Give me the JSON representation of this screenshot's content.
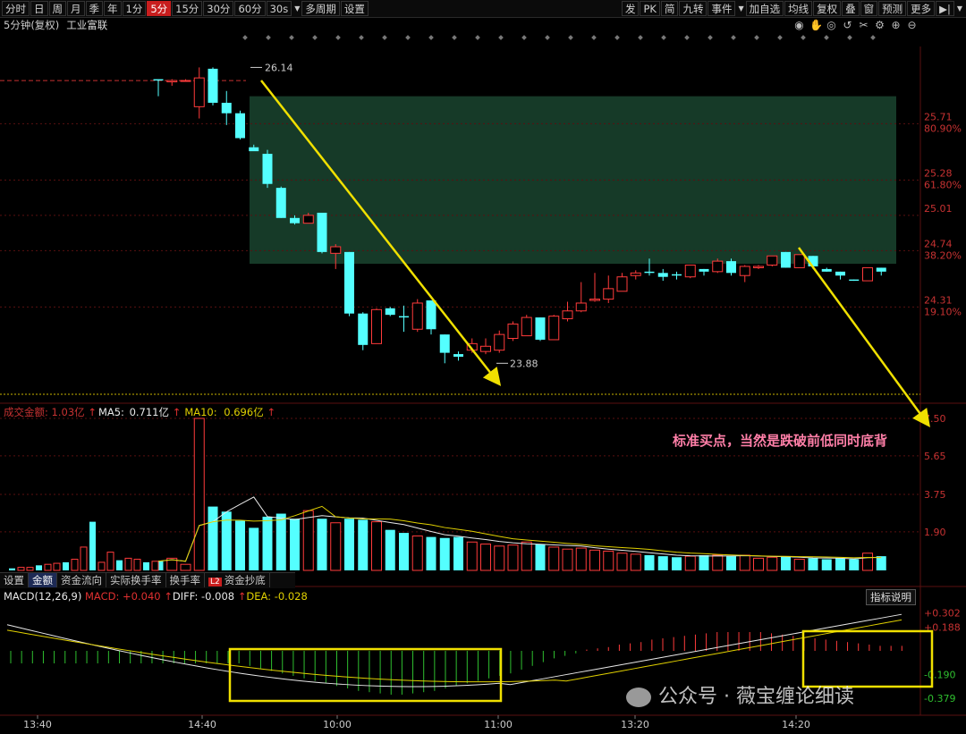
{
  "toolbar": {
    "left_buttons": [
      "分时",
      "日",
      "周",
      "月",
      "季",
      "年",
      "1分",
      "5分",
      "15分",
      "30分",
      "60分",
      "30s",
      "多周期",
      "设置"
    ],
    "active_button": "5分",
    "right_buttons": [
      "发",
      "PK",
      "简",
      "九转",
      "事件",
      "加自选",
      "均线",
      "复权",
      "叠",
      "窗",
      "预测",
      "更多"
    ]
  },
  "caption": {
    "period": "5分钟(复权)",
    "stock_name": "工业富联"
  },
  "price_labels": {
    "high": "26.14",
    "low": "23.88",
    "axis": [
      {
        "price": "25.71",
        "pct": "80.90%"
      },
      {
        "price": "25.28",
        "pct": "61.80%"
      },
      {
        "price": "25.01",
        "pct": ""
      },
      {
        "price": "24.74",
        "pct": "38.20%"
      },
      {
        "price": "24.31",
        "pct": "19.10%"
      }
    ]
  },
  "volume": {
    "title": "成交金额:",
    "value": "1.03亿",
    "ma5_label": "MA5:",
    "ma5_value": "0.711亿",
    "ma10_label": "MA10:",
    "ma10_value": "0.696亿",
    "axis": [
      "7.50",
      "5.65",
      "3.75",
      "1.90"
    ]
  },
  "tabs": [
    "设置",
    "金额",
    "资金流向",
    "实际换手率",
    "换手率",
    "资金抄底"
  ],
  "active_tab": "金额",
  "tab_badge": "L2",
  "macd": {
    "title": "MACD(12,26,9)",
    "macd_label": "MACD:",
    "macd_value": "+0.040",
    "diff_label": "DIFF:",
    "diff_value": "-0.008",
    "dea_label": "DEA:",
    "dea_value": "-0.028",
    "axis": [
      "+0.302",
      "+0.188",
      "-0.190",
      "-0.379"
    ],
    "indicator_button": "指标说明"
  },
  "time_axis": [
    "13:40",
    "14:40",
    "10:00",
    "11:00",
    "13:20",
    "14:20"
  ],
  "annotation": "标准买点，当然是跌破前低同时底背",
  "watermark": "公众号 · 薇宝缠论细读",
  "colors": {
    "up": "#ff3b3b",
    "down": "#54ffff",
    "ma5": "#e8e8e8",
    "ma10": "#e0d000",
    "zone": "#163a28",
    "arrow": "#f0e000",
    "box": "#f0e000",
    "annotation": "#ff7fa8"
  },
  "chart_data": {
    "type": "candlestick",
    "candles": [
      {
        "o": 26.05,
        "h": 26.05,
        "l": 25.92,
        "c": 26.04,
        "v": 0.45
      },
      {
        "o": 26.03,
        "h": 26.05,
        "l": 26.0,
        "c": 26.04,
        "v": 0.6
      },
      {
        "o": 26.04,
        "h": 26.05,
        "l": 26.03,
        "c": 26.04,
        "v": 0.3
      },
      {
        "o": 25.84,
        "h": 26.14,
        "l": 25.75,
        "c": 26.06,
        "v": 7.5
      },
      {
        "o": 26.13,
        "h": 26.14,
        "l": 25.85,
        "c": 25.87,
        "v": 3.15
      },
      {
        "o": 25.87,
        "h": 25.96,
        "l": 25.7,
        "c": 25.79,
        "v": 2.9
      },
      {
        "o": 25.79,
        "h": 25.81,
        "l": 25.59,
        "c": 25.6,
        "v": 2.45
      },
      {
        "o": 25.53,
        "h": 25.55,
        "l": 25.52,
        "c": 25.5,
        "v": 2.1
      },
      {
        "o": 25.48,
        "h": 25.51,
        "l": 25.22,
        "c": 25.25,
        "v": 2.65
      },
      {
        "o": 25.22,
        "h": 25.23,
        "l": 24.99,
        "c": 24.99,
        "v": 2.8
      },
      {
        "o": 24.99,
        "h": 25.01,
        "l": 24.94,
        "c": 24.95,
        "v": 2.55
      },
      {
        "o": 24.95,
        "h": 25.03,
        "l": 24.95,
        "c": 25.01,
        "v": 2.95
      },
      {
        "o": 25.03,
        "h": 25.03,
        "l": 24.72,
        "c": 24.73,
        "v": 2.55
      },
      {
        "o": 24.72,
        "h": 24.79,
        "l": 24.6,
        "c": 24.77,
        "v": 2.35
      },
      {
        "o": 24.73,
        "h": 24.73,
        "l": 24.24,
        "c": 24.26,
        "v": 2.55
      },
      {
        "o": 24.26,
        "h": 24.27,
        "l": 23.98,
        "c": 24.02,
        "v": 2.5
      },
      {
        "o": 24.03,
        "h": 24.3,
        "l": 24.03,
        "c": 24.29,
        "v": 2.4
      },
      {
        "o": 24.3,
        "h": 24.31,
        "l": 24.24,
        "c": 24.25,
        "v": 2.0
      },
      {
        "o": 24.24,
        "h": 24.32,
        "l": 24.12,
        "c": 24.23,
        "v": 1.85
      },
      {
        "o": 24.14,
        "h": 24.37,
        "l": 24.12,
        "c": 24.34,
        "v": 1.7
      },
      {
        "o": 24.36,
        "h": 24.36,
        "l": 24.1,
        "c": 24.14,
        "v": 1.65
      },
      {
        "o": 24.1,
        "h": 24.1,
        "l": 23.88,
        "c": 23.96,
        "v": 1.6
      },
      {
        "o": 23.95,
        "h": 23.97,
        "l": 23.9,
        "c": 23.93,
        "v": 1.65
      },
      {
        "o": 23.98,
        "h": 24.07,
        "l": 23.96,
        "c": 24.03,
        "v": 1.4
      },
      {
        "o": 23.97,
        "h": 24.07,
        "l": 23.95,
        "c": 24.01,
        "v": 1.3
      },
      {
        "o": 23.98,
        "h": 24.13,
        "l": 23.96,
        "c": 24.1,
        "v": 1.2
      },
      {
        "o": 24.07,
        "h": 24.2,
        "l": 24.05,
        "c": 24.18,
        "v": 1.25
      },
      {
        "o": 24.09,
        "h": 24.25,
        "l": 24.09,
        "c": 24.23,
        "v": 1.4
      },
      {
        "o": 24.23,
        "h": 24.23,
        "l": 24.05,
        "c": 24.06,
        "v": 1.3
      },
      {
        "o": 24.06,
        "h": 24.25,
        "l": 24.06,
        "c": 24.24,
        "v": 1.15
      },
      {
        "o": 24.22,
        "h": 24.35,
        "l": 24.2,
        "c": 24.28,
        "v": 1.05
      },
      {
        "o": 24.28,
        "h": 24.5,
        "l": 24.27,
        "c": 24.34,
        "v": 1.1
      },
      {
        "o": 24.36,
        "h": 24.57,
        "l": 24.35,
        "c": 24.37,
        "v": 1.0
      },
      {
        "o": 24.37,
        "h": 24.55,
        "l": 24.34,
        "c": 24.45,
        "v": 0.95
      },
      {
        "o": 24.43,
        "h": 24.57,
        "l": 24.43,
        "c": 24.54,
        "v": 0.85
      },
      {
        "o": 24.55,
        "h": 24.59,
        "l": 24.52,
        "c": 24.57,
        "v": 0.8
      },
      {
        "o": 24.58,
        "h": 24.68,
        "l": 24.55,
        "c": 24.57,
        "v": 0.75
      },
      {
        "o": 24.57,
        "h": 24.6,
        "l": 24.51,
        "c": 24.54,
        "v": 0.7
      },
      {
        "o": 24.56,
        "h": 24.58,
        "l": 24.52,
        "c": 24.55,
        "v": 0.65
      },
      {
        "o": 24.54,
        "h": 24.63,
        "l": 24.53,
        "c": 24.63,
        "v": 0.7
      },
      {
        "o": 24.6,
        "h": 24.6,
        "l": 24.55,
        "c": 24.58,
        "v": 0.75
      },
      {
        "o": 24.58,
        "h": 24.68,
        "l": 24.57,
        "c": 24.66,
        "v": 0.75
      },
      {
        "o": 24.66,
        "h": 24.68,
        "l": 24.55,
        "c": 24.57,
        "v": 0.7
      },
      {
        "o": 24.55,
        "h": 24.63,
        "l": 24.5,
        "c": 24.62,
        "v": 0.75
      },
      {
        "o": 24.61,
        "h": 24.63,
        "l": 24.6,
        "c": 24.62,
        "v": 0.6
      },
      {
        "o": 24.63,
        "h": 24.7,
        "l": 24.62,
        "c": 24.7,
        "v": 0.65
      },
      {
        "o": 24.73,
        "h": 24.73,
        "l": 24.61,
        "c": 24.61,
        "v": 0.7
      },
      {
        "o": 24.61,
        "h": 24.71,
        "l": 24.61,
        "c": 24.71,
        "v": 0.55
      },
      {
        "o": 24.7,
        "h": 24.7,
        "l": 24.6,
        "c": 24.62,
        "v": 0.6
      },
      {
        "o": 24.6,
        "h": 24.61,
        "l": 24.58,
        "c": 24.58,
        "v": 0.55
      },
      {
        "o": 24.58,
        "h": 24.58,
        "l": 24.52,
        "c": 24.55,
        "v": 0.6
      },
      {
        "o": 24.52,
        "h": 24.52,
        "l": 24.51,
        "c": 24.51,
        "v": 0.55
      },
      {
        "o": 24.51,
        "h": 24.61,
        "l": 24.51,
        "c": 24.61,
        "v": 0.85
      },
      {
        "o": 24.61,
        "h": 24.61,
        "l": 24.55,
        "c": 24.58,
        "v": 0.7
      }
    ],
    "fib_levels": [
      {
        "price": 25.71,
        "pct": "80.90%"
      },
      {
        "price": 25.28,
        "pct": "61.80%"
      },
      {
        "price": 25.01,
        "pct": ""
      },
      {
        "price": 24.74,
        "pct": "38.20%"
      },
      {
        "price": 24.31,
        "pct": "19.10%"
      }
    ],
    "macd_hist": [
      -0.1,
      -0.1,
      -0.1,
      -0.1,
      -0.1,
      -0.1,
      -0.1,
      -0.1,
      -0.1,
      -0.1,
      -0.1,
      -0.1,
      -0.1,
      -0.1,
      -0.1,
      -0.1,
      -0.1,
      -0.1,
      -0.1,
      -0.1,
      -0.1,
      -0.1,
      -0.12,
      -0.14,
      -0.16,
      -0.18,
      -0.2,
      -0.22,
      -0.24,
      -0.26,
      -0.28,
      -0.3,
      -0.32,
      -0.33,
      -0.34,
      -0.35,
      -0.35,
      -0.34,
      -0.33,
      -0.32,
      -0.3,
      -0.28,
      -0.26,
      -0.24,
      -0.22,
      -0.2,
      -0.18,
      -0.15,
      -0.12,
      -0.09,
      -0.06,
      -0.04,
      -0.02,
      0.01,
      0.02,
      0.03,
      0.05,
      0.06,
      0.07,
      0.09,
      0.1,
      0.11,
      0.12,
      0.13,
      0.14,
      0.15,
      0.15,
      0.15,
      0.15,
      0.15,
      0.14,
      0.13,
      0.12,
      0.11,
      0.1,
      0.09,
      0.08,
      0.07,
      0.06,
      0.05,
      0.04,
      0.04,
      0.04
    ]
  }
}
